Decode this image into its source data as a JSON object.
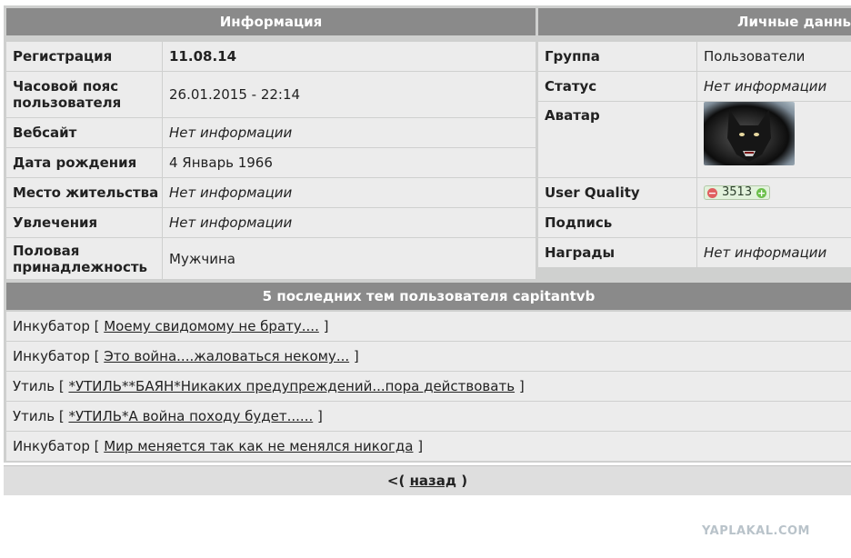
{
  "info": {
    "title": "Информация",
    "rows": [
      {
        "label": "Регистрация",
        "value": "11.08.14"
      },
      {
        "label": "Часовой пояс пользователя",
        "value": "26.01.2015 - 22:14"
      },
      {
        "label": "Вебсайт",
        "value": "Нет информации"
      },
      {
        "label": "Дата рождения",
        "value": "4 Январь 1966"
      },
      {
        "label": "Место жительства",
        "value": "Нет информации"
      },
      {
        "label": "Увлечения",
        "value": "Нет информации"
      },
      {
        "label": "Половая принадлежность",
        "value": "Мужчина"
      }
    ]
  },
  "personal": {
    "title": "Личные данные",
    "rows": [
      {
        "label": "Группа",
        "value": "Пользователи"
      },
      {
        "label": "Статус",
        "value": "Нет информации"
      },
      {
        "label": "Аватар",
        "value": ""
      },
      {
        "label": "User Quality",
        "value": "3513"
      },
      {
        "label": "Подпись",
        "value": ""
      },
      {
        "label": "Награды",
        "value": "Нет информации"
      }
    ]
  },
  "topics": {
    "title": "5 последних тем пользователя capitantvb",
    "items": [
      {
        "forum": "Инкубатор",
        "title": "Моему свидомому не брату...."
      },
      {
        "forum": "Инкубатор",
        "title": "Это война....жаловаться некому..."
      },
      {
        "forum": "Утиль",
        "title": "*УТИЛЬ**БАЯН*Никаких предупреждений...пора действовать"
      },
      {
        "forum": "Утиль",
        "title": "*УТИЛЬ*А война походу будет......"
      },
      {
        "forum": "Инкубатор",
        "title": "Мир меняется так как не менялся никогда"
      }
    ]
  },
  "nav": {
    "prefix": "<(",
    "back_label": "назад",
    "suffix": ")"
  },
  "watermark": "YAPLAKAL.COM",
  "icons": {
    "uq_minus": "minus-icon",
    "uq_plus": "plus-icon"
  },
  "colors": {
    "header_bg": "#8a8a8a",
    "cell_bg": "#ececec",
    "border": "#cfd0cf",
    "badge_bg": "#e2f2dc"
  }
}
